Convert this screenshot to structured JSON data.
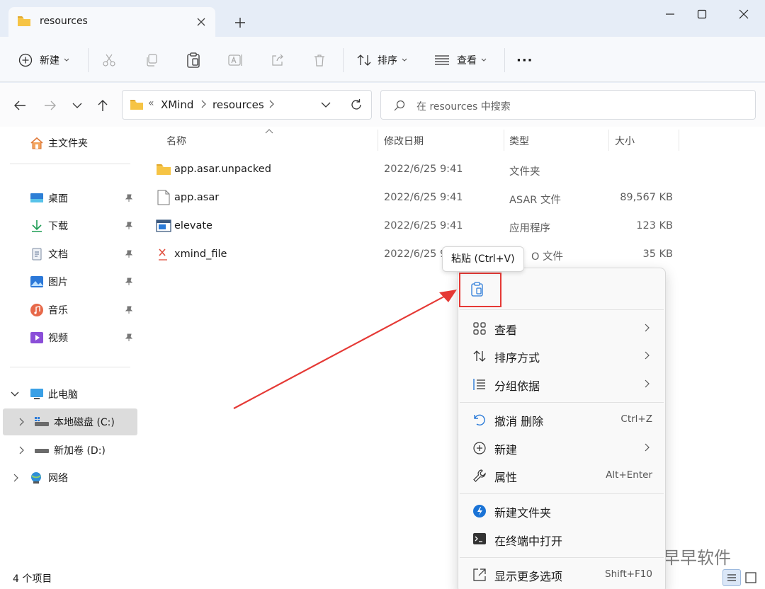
{
  "tab": {
    "title": "resources"
  },
  "toolbar": {
    "new_label": "新建",
    "sort_label": "排序",
    "view_label": "查看",
    "more_label": "···"
  },
  "address": {
    "overflow": "«",
    "segments": [
      "XMind",
      "resources"
    ]
  },
  "search": {
    "placeholder": "在 resources 中搜索"
  },
  "sidebar": {
    "home": "主文件夹",
    "quick_access": [
      {
        "label": "桌面",
        "icon": "desktop-icon"
      },
      {
        "label": "下载",
        "icon": "download-icon"
      },
      {
        "label": "文档",
        "icon": "documents-icon"
      },
      {
        "label": "图片",
        "icon": "pictures-icon"
      },
      {
        "label": "音乐",
        "icon": "music-icon"
      },
      {
        "label": "视频",
        "icon": "video-icon"
      }
    ],
    "this_pc": "此电脑",
    "drives": [
      {
        "label": "本地磁盘 (C:)",
        "selected": true
      },
      {
        "label": "新加卷 (D:)",
        "selected": false
      }
    ],
    "network": "网络"
  },
  "columns": {
    "name": "名称",
    "date": "修改日期",
    "type": "类型",
    "size": "大小"
  },
  "files": [
    {
      "name": "app.asar.unpacked",
      "date": "2022/6/25 9:41",
      "type": "文件夹",
      "size": "",
      "icon": "folder-icon"
    },
    {
      "name": "app.asar",
      "date": "2022/6/25 9:41",
      "type": "ASAR 文件",
      "size": "89,567 KB",
      "icon": "file-icon"
    },
    {
      "name": "elevate",
      "date": "2022/6/25 9:41",
      "type": "应用程序",
      "size": "123 KB",
      "icon": "app-icon"
    },
    {
      "name": "xmind_file",
      "date": "2022/6/25 9",
      "type": "O 文件",
      "size": "35 KB",
      "icon": "xmind-file-icon"
    }
  ],
  "status": {
    "count": "4 个项目"
  },
  "tooltip": {
    "text": "粘贴 (Ctrl+V)"
  },
  "context_menu": {
    "view": "查看",
    "sort": "排序方式",
    "group": "分组依据",
    "undo": "撤消 删除",
    "undo_shortcut": "Ctrl+Z",
    "new": "新建",
    "properties": "属性",
    "properties_shortcut": "Alt+Enter",
    "new_folder": "新建文件夹",
    "terminal": "在终端中打开",
    "more": "显示更多选项",
    "more_shortcut": "Shift+F10"
  },
  "watermark": {
    "text": "早早软件"
  },
  "colors": {
    "accent": "#0067c0",
    "highlight": "#e53935",
    "selected": "#dcdcdc",
    "folder": "#f6c445"
  }
}
